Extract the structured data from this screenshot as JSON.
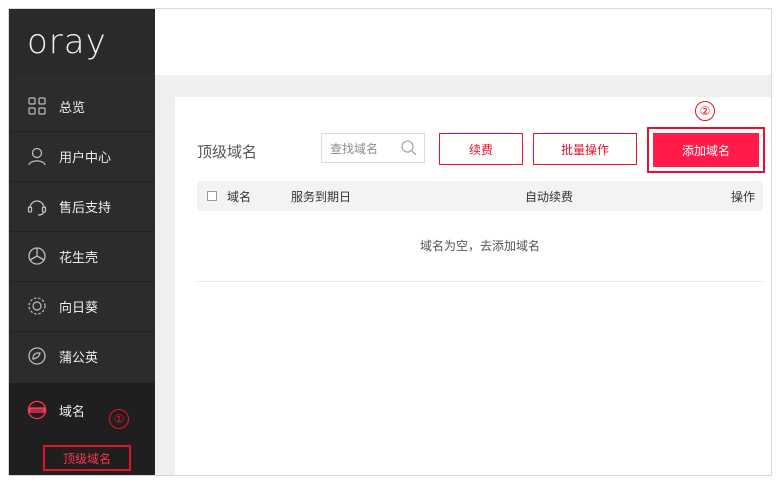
{
  "brand": {
    "logo_text": "oray"
  },
  "sidebar": {
    "items": [
      {
        "label": "总览",
        "icon": "grid-icon"
      },
      {
        "label": "用户中心",
        "icon": "user-icon"
      },
      {
        "label": "售后支持",
        "icon": "support-icon"
      },
      {
        "label": "花生壳",
        "icon": "peanut-shell-icon"
      },
      {
        "label": "向日葵",
        "icon": "sunflower-icon"
      },
      {
        "label": "蒲公英",
        "icon": "dandelion-icon"
      },
      {
        "label": "域名",
        "icon": "www-icon"
      }
    ],
    "sub_item": {
      "label": "顶级域名"
    },
    "annotation_1": "①"
  },
  "toolbar": {
    "title": "顶级域名",
    "search_placeholder": "查找域名",
    "renew_label": "续费",
    "batch_label": "批量操作",
    "add_label": "添加域名",
    "annotation_2": "②"
  },
  "table": {
    "columns": [
      "域名",
      "服务到期日",
      "自动续费",
      "操作"
    ],
    "empty_text": "域名为空，去添加域名"
  },
  "colors": {
    "accent": "#ff1c4a",
    "annotation_red": "#e8112d",
    "sidebar_bg": "#2c2c2c"
  }
}
